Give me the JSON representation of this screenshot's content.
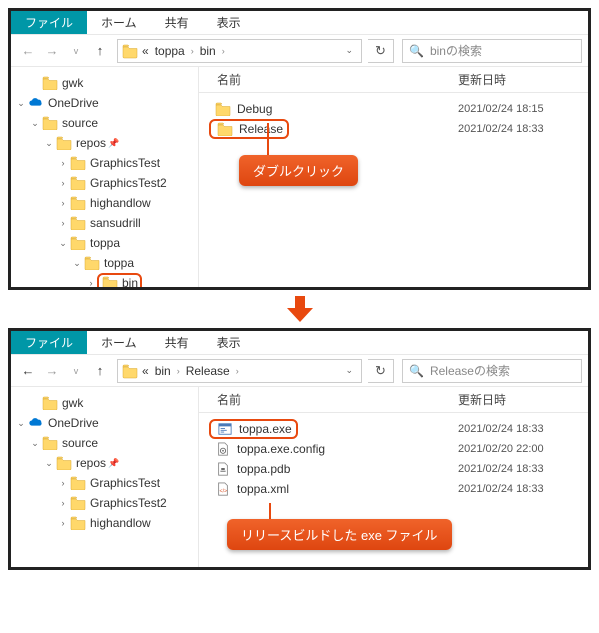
{
  "window1": {
    "menubar": {
      "file": "ファイル",
      "home": "ホーム",
      "share": "共有",
      "view": "表示"
    },
    "address": {
      "prefix": "«",
      "parts": [
        "toppa",
        "bin"
      ]
    },
    "search": {
      "placeholder": "binの検索"
    },
    "tree": [
      {
        "indent": 1,
        "exp": "",
        "icon": "folder",
        "label": "gwk"
      },
      {
        "indent": 0,
        "exp": "v",
        "icon": "onedrive",
        "label": "OneDrive"
      },
      {
        "indent": 1,
        "exp": "v",
        "icon": "folder",
        "label": "source"
      },
      {
        "indent": 2,
        "exp": "v",
        "icon": "folder",
        "label": "repos",
        "pin": true
      },
      {
        "indent": 3,
        "exp": ">",
        "icon": "folder",
        "label": "GraphicsTest"
      },
      {
        "indent": 3,
        "exp": ">",
        "icon": "folder",
        "label": "GraphicsTest2"
      },
      {
        "indent": 3,
        "exp": ">",
        "icon": "folder",
        "label": "highandlow"
      },
      {
        "indent": 3,
        "exp": ">",
        "icon": "folder",
        "label": "sansudrill"
      },
      {
        "indent": 3,
        "exp": "v",
        "icon": "folder",
        "label": "toppa"
      },
      {
        "indent": 4,
        "exp": "v",
        "icon": "folder",
        "label": "toppa"
      },
      {
        "indent": 5,
        "exp": ">",
        "icon": "folder",
        "label": "bin",
        "highlight": true
      }
    ],
    "columns": {
      "name": "名前",
      "date": "更新日時"
    },
    "rows": [
      {
        "icon": "folder",
        "name": "Debug",
        "date": "2021/02/24 18:15"
      },
      {
        "icon": "folder",
        "name": "Release",
        "date": "2021/02/24 18:33",
        "highlight": true
      }
    ],
    "callout": "ダブルクリック"
  },
  "window2": {
    "menubar": {
      "file": "ファイル",
      "home": "ホーム",
      "share": "共有",
      "view": "表示"
    },
    "address": {
      "prefix": "«",
      "parts": [
        "bin",
        "Release"
      ]
    },
    "search": {
      "placeholder": "Releaseの検索"
    },
    "tree": [
      {
        "indent": 1,
        "exp": "",
        "icon": "folder",
        "label": "gwk"
      },
      {
        "indent": 0,
        "exp": "v",
        "icon": "onedrive",
        "label": "OneDrive"
      },
      {
        "indent": 1,
        "exp": "v",
        "icon": "folder",
        "label": "source"
      },
      {
        "indent": 2,
        "exp": "v",
        "icon": "folder",
        "label": "repos",
        "pin": true
      },
      {
        "indent": 3,
        "exp": ">",
        "icon": "folder",
        "label": "GraphicsTest"
      },
      {
        "indent": 3,
        "exp": ">",
        "icon": "folder",
        "label": "GraphicsTest2"
      },
      {
        "indent": 3,
        "exp": ">",
        "icon": "folder",
        "label": "highandlow"
      }
    ],
    "columns": {
      "name": "名前",
      "date": "更新日時"
    },
    "rows": [
      {
        "icon": "exe",
        "name": "toppa.exe",
        "date": "2021/02/24 18:33",
        "highlight": true
      },
      {
        "icon": "config",
        "name": "toppa.exe.config",
        "date": "2021/02/20 22:00"
      },
      {
        "icon": "pdb",
        "name": "toppa.pdb",
        "date": "2021/02/24 18:33"
      },
      {
        "icon": "xml",
        "name": "toppa.xml",
        "date": "2021/02/24 18:33"
      }
    ],
    "callout": "リリースビルドした exe ファイル"
  }
}
